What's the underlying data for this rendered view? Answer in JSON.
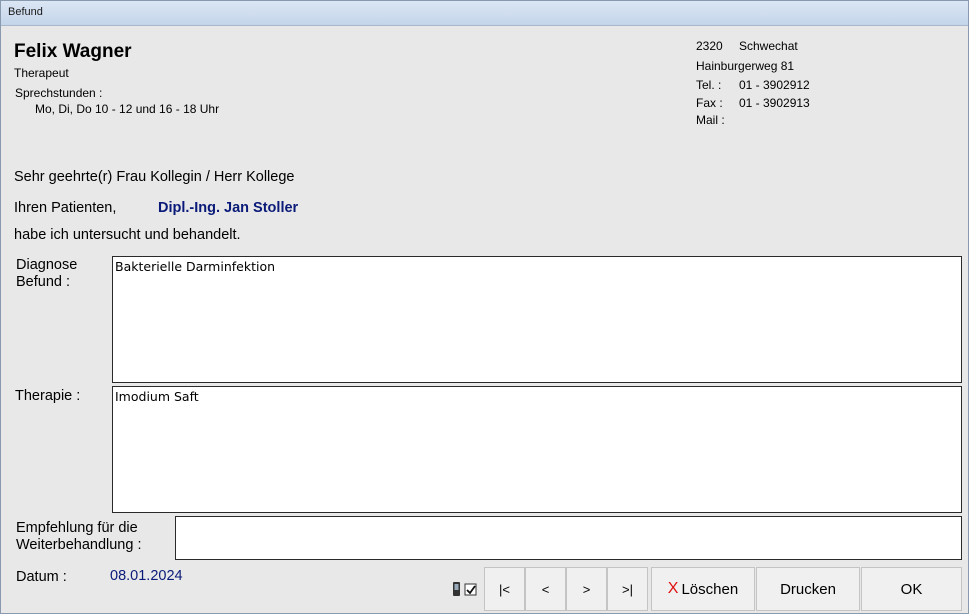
{
  "window": {
    "title": "Befund"
  },
  "doctor": {
    "name": "Felix Wagner",
    "role": "Therapeut",
    "hours_label": "Sprechstunden :",
    "hours": "Mo, Di, Do 10 - 12 und 16 - 18 Uhr"
  },
  "address": {
    "zip": "2320",
    "city": "Schwechat",
    "street": "Hainburgerweg 81",
    "tel_label": "Tel. :",
    "tel": "01 - 3902912",
    "fax_label": "Fax :",
    "fax": "01 - 3902913",
    "mail_label": "Mail :"
  },
  "letter": {
    "salutation": "Sehr geehrte(r) Frau Kollegin / Herr Kollege",
    "patient_prefix": "Ihren Patienten,",
    "patient_name": "Dipl.-Ing.  Jan Stoller",
    "statement": "habe ich untersucht und behandelt."
  },
  "fields": {
    "diagnose_label_1": "Diagnose",
    "diagnose_label_2": "Befund :",
    "diagnose_value": "Bakterielle Darminfektion",
    "therapie_label": "Therapie :",
    "therapie_value": "Imodium Saft",
    "empfehlung_label_1": "Empfehlung für die",
    "empfehlung_label_2": "Weiterbehandlung :",
    "empfehlung_value": "",
    "datum_label": "Datum :",
    "datum_value": "08.01.2024"
  },
  "buttons": {
    "first": "|<",
    "prev": "<",
    "next": ">",
    "last": ">|",
    "delete": "Löschen",
    "delete_icon": "x-icon",
    "print": "Drucken",
    "ok": "OK"
  },
  "colors": {
    "accent_blue": "#0a1a78",
    "delete_red": "#e01010"
  }
}
